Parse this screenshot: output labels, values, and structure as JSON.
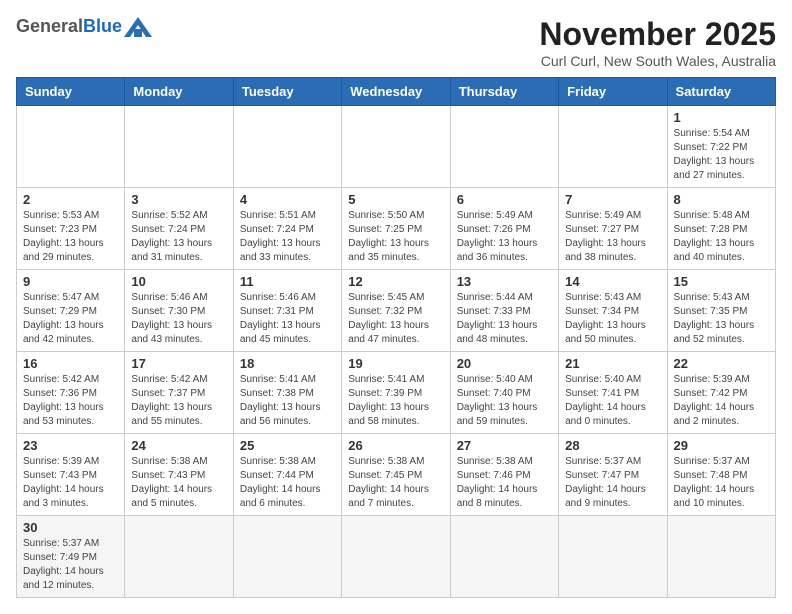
{
  "header": {
    "logo_general": "General",
    "logo_blue": "Blue",
    "month_title": "November 2025",
    "subtitle": "Curl Curl, New South Wales, Australia"
  },
  "weekdays": [
    "Sunday",
    "Monday",
    "Tuesday",
    "Wednesday",
    "Thursday",
    "Friday",
    "Saturday"
  ],
  "weeks": [
    [
      {
        "day": "",
        "info": ""
      },
      {
        "day": "",
        "info": ""
      },
      {
        "day": "",
        "info": ""
      },
      {
        "day": "",
        "info": ""
      },
      {
        "day": "",
        "info": ""
      },
      {
        "day": "",
        "info": ""
      },
      {
        "day": "1",
        "info": "Sunrise: 5:54 AM\nSunset: 7:22 PM\nDaylight: 13 hours and 27 minutes."
      }
    ],
    [
      {
        "day": "2",
        "info": "Sunrise: 5:53 AM\nSunset: 7:23 PM\nDaylight: 13 hours and 29 minutes."
      },
      {
        "day": "3",
        "info": "Sunrise: 5:52 AM\nSunset: 7:24 PM\nDaylight: 13 hours and 31 minutes."
      },
      {
        "day": "4",
        "info": "Sunrise: 5:51 AM\nSunset: 7:24 PM\nDaylight: 13 hours and 33 minutes."
      },
      {
        "day": "5",
        "info": "Sunrise: 5:50 AM\nSunset: 7:25 PM\nDaylight: 13 hours and 35 minutes."
      },
      {
        "day": "6",
        "info": "Sunrise: 5:49 AM\nSunset: 7:26 PM\nDaylight: 13 hours and 36 minutes."
      },
      {
        "day": "7",
        "info": "Sunrise: 5:49 AM\nSunset: 7:27 PM\nDaylight: 13 hours and 38 minutes."
      },
      {
        "day": "8",
        "info": "Sunrise: 5:48 AM\nSunset: 7:28 PM\nDaylight: 13 hours and 40 minutes."
      }
    ],
    [
      {
        "day": "9",
        "info": "Sunrise: 5:47 AM\nSunset: 7:29 PM\nDaylight: 13 hours and 42 minutes."
      },
      {
        "day": "10",
        "info": "Sunrise: 5:46 AM\nSunset: 7:30 PM\nDaylight: 13 hours and 43 minutes."
      },
      {
        "day": "11",
        "info": "Sunrise: 5:46 AM\nSunset: 7:31 PM\nDaylight: 13 hours and 45 minutes."
      },
      {
        "day": "12",
        "info": "Sunrise: 5:45 AM\nSunset: 7:32 PM\nDaylight: 13 hours and 47 minutes."
      },
      {
        "day": "13",
        "info": "Sunrise: 5:44 AM\nSunset: 7:33 PM\nDaylight: 13 hours and 48 minutes."
      },
      {
        "day": "14",
        "info": "Sunrise: 5:43 AM\nSunset: 7:34 PM\nDaylight: 13 hours and 50 minutes."
      },
      {
        "day": "15",
        "info": "Sunrise: 5:43 AM\nSunset: 7:35 PM\nDaylight: 13 hours and 52 minutes."
      }
    ],
    [
      {
        "day": "16",
        "info": "Sunrise: 5:42 AM\nSunset: 7:36 PM\nDaylight: 13 hours and 53 minutes."
      },
      {
        "day": "17",
        "info": "Sunrise: 5:42 AM\nSunset: 7:37 PM\nDaylight: 13 hours and 55 minutes."
      },
      {
        "day": "18",
        "info": "Sunrise: 5:41 AM\nSunset: 7:38 PM\nDaylight: 13 hours and 56 minutes."
      },
      {
        "day": "19",
        "info": "Sunrise: 5:41 AM\nSunset: 7:39 PM\nDaylight: 13 hours and 58 minutes."
      },
      {
        "day": "20",
        "info": "Sunrise: 5:40 AM\nSunset: 7:40 PM\nDaylight: 13 hours and 59 minutes."
      },
      {
        "day": "21",
        "info": "Sunrise: 5:40 AM\nSunset: 7:41 PM\nDaylight: 14 hours and 0 minutes."
      },
      {
        "day": "22",
        "info": "Sunrise: 5:39 AM\nSunset: 7:42 PM\nDaylight: 14 hours and 2 minutes."
      }
    ],
    [
      {
        "day": "23",
        "info": "Sunrise: 5:39 AM\nSunset: 7:43 PM\nDaylight: 14 hours and 3 minutes."
      },
      {
        "day": "24",
        "info": "Sunrise: 5:38 AM\nSunset: 7:43 PM\nDaylight: 14 hours and 5 minutes."
      },
      {
        "day": "25",
        "info": "Sunrise: 5:38 AM\nSunset: 7:44 PM\nDaylight: 14 hours and 6 minutes."
      },
      {
        "day": "26",
        "info": "Sunrise: 5:38 AM\nSunset: 7:45 PM\nDaylight: 14 hours and 7 minutes."
      },
      {
        "day": "27",
        "info": "Sunrise: 5:38 AM\nSunset: 7:46 PM\nDaylight: 14 hours and 8 minutes."
      },
      {
        "day": "28",
        "info": "Sunrise: 5:37 AM\nSunset: 7:47 PM\nDaylight: 14 hours and 9 minutes."
      },
      {
        "day": "29",
        "info": "Sunrise: 5:37 AM\nSunset: 7:48 PM\nDaylight: 14 hours and 10 minutes."
      }
    ],
    [
      {
        "day": "30",
        "info": "Sunrise: 5:37 AM\nSunset: 7:49 PM\nDaylight: 14 hours and 12 minutes."
      },
      {
        "day": "",
        "info": ""
      },
      {
        "day": "",
        "info": ""
      },
      {
        "day": "",
        "info": ""
      },
      {
        "day": "",
        "info": ""
      },
      {
        "day": "",
        "info": ""
      },
      {
        "day": "",
        "info": ""
      }
    ]
  ]
}
